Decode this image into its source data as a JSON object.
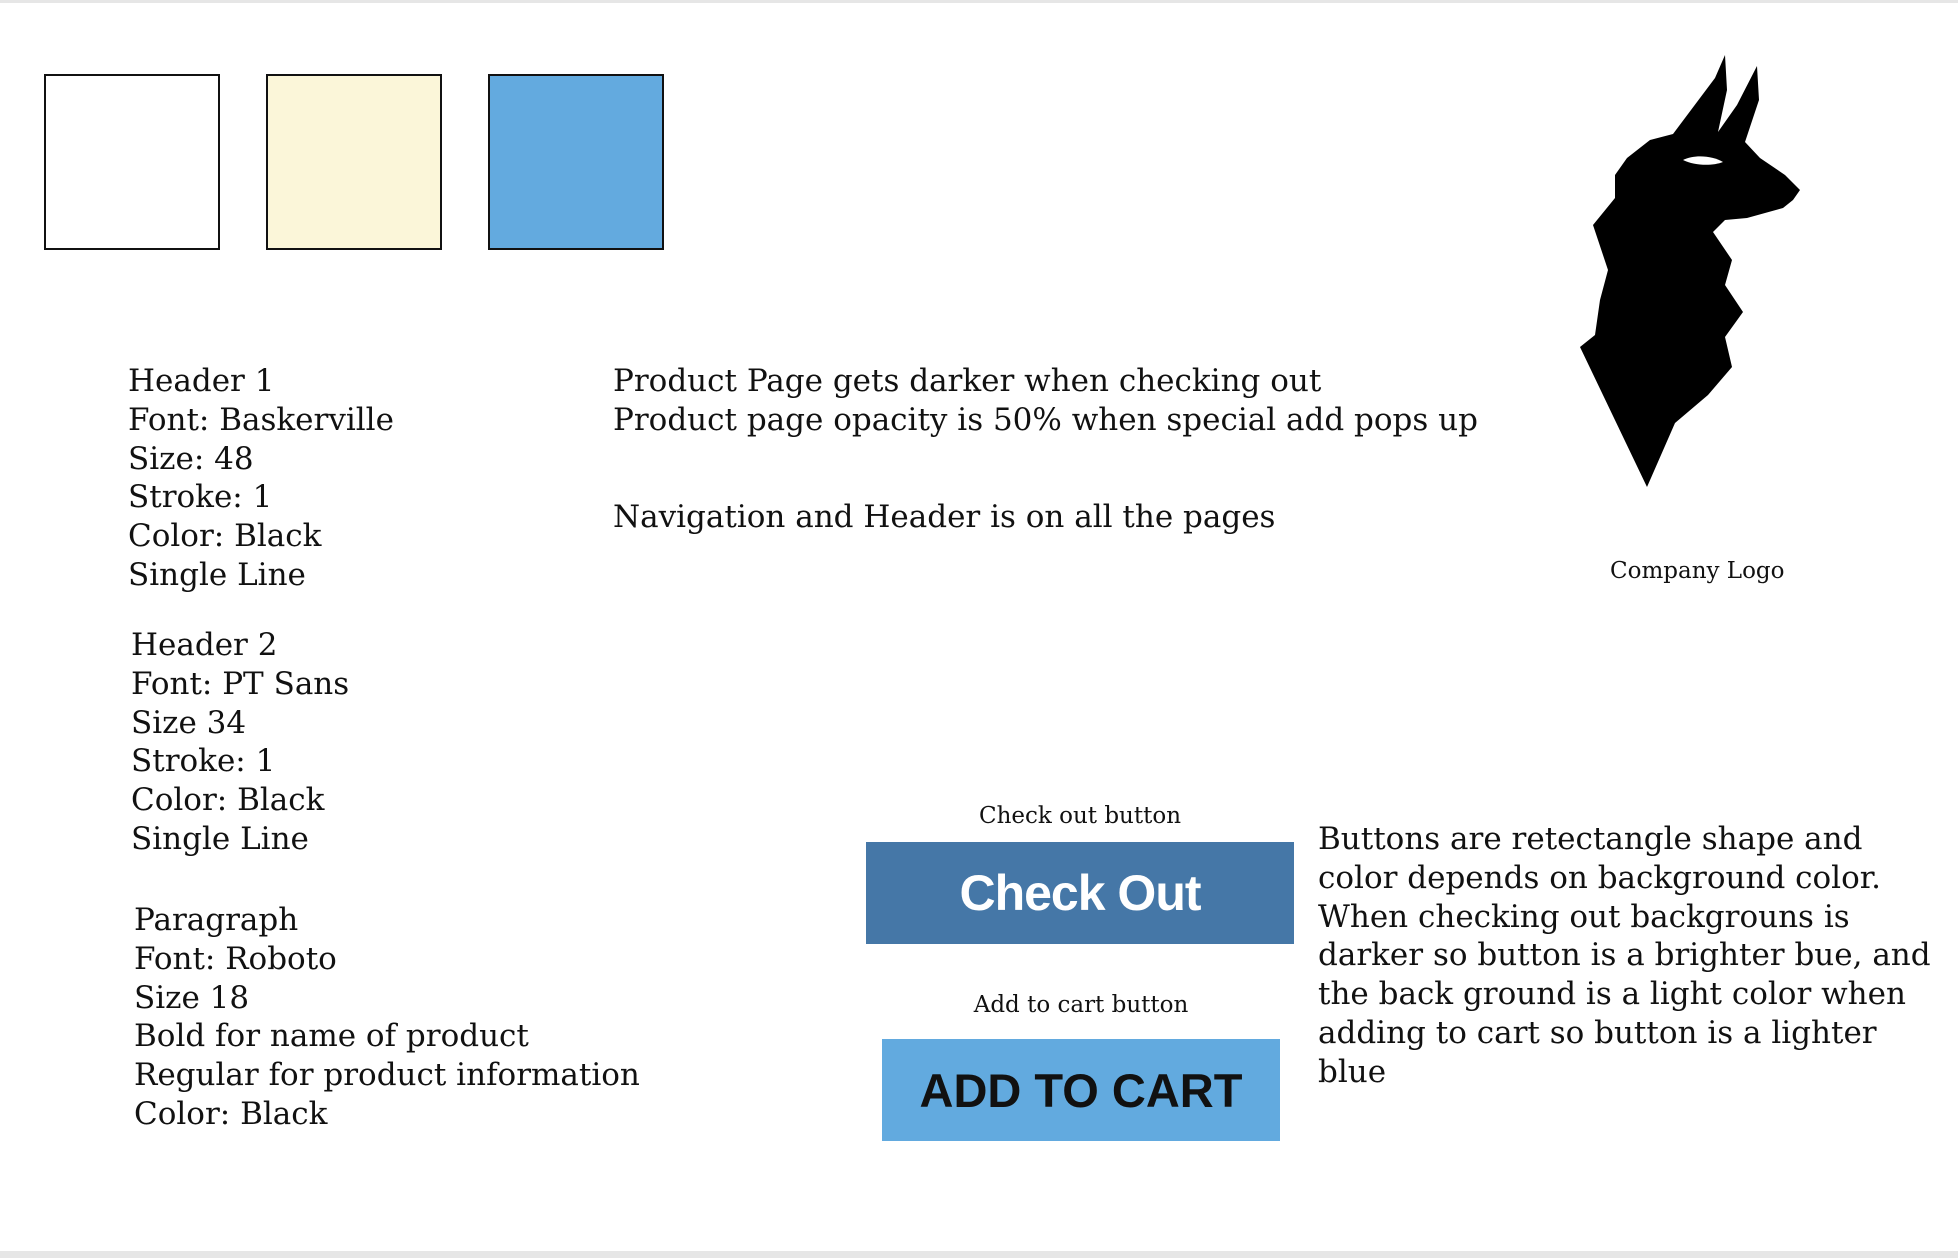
{
  "palette": [
    {
      "name": "white",
      "color": "#FFFFFF"
    },
    {
      "name": "cream",
      "color": "#FBF6D9"
    },
    {
      "name": "blue",
      "color": "#63AADF"
    }
  ],
  "header1": {
    "lines": [
      "Header 1",
      "Font: Baskerville",
      "Size: 48",
      "Stroke: 1",
      "Color: Black",
      "Single Line"
    ]
  },
  "header2": {
    "lines": [
      "Header 2",
      "Font: PT Sans",
      "Size 34",
      "Stroke: 1",
      "Color: Black",
      "Single Line"
    ]
  },
  "paragraph": {
    "lines": [
      "Paragraph",
      "Font: Roboto",
      "Size 18",
      "Bold for name of product",
      "Regular for product information",
      "Color: Black"
    ]
  },
  "notes": {
    "line1": "Product Page gets darker when checking out",
    "line2": "Product page opacity is 50% when special add pops up",
    "line3": "Navigation and Header is on all the pages"
  },
  "logo": {
    "icon": "llama-head-icon",
    "caption": "Company Logo"
  },
  "checkout": {
    "caption": "Check out button",
    "label": "Check Out",
    "color": "#4577A7"
  },
  "addcart": {
    "caption": "Add to cart button",
    "label": "ADD TO CART",
    "color": "#62AADF"
  },
  "buttons_note": "Buttons are retectangle shape and color depends on background color. When checking out backgrouns is darker so button is a brighter bue, and the back ground is a light color when adding to cart so button is a lighter blue"
}
